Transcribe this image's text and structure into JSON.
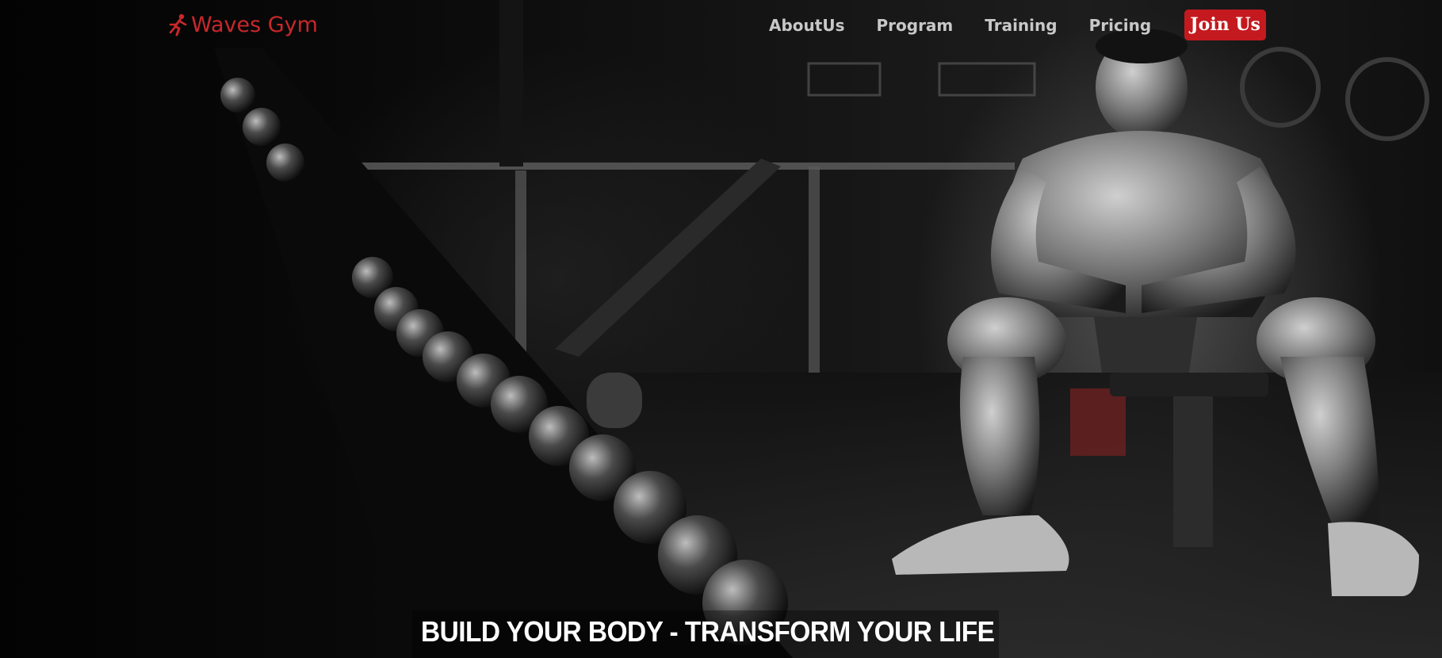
{
  "header": {
    "logo_text": "Waves Gym",
    "logo_icon": "running-man-icon"
  },
  "nav": {
    "items": [
      {
        "label": "AboutUs"
      },
      {
        "label": "Program"
      },
      {
        "label": "Training"
      },
      {
        "label": "Pricing"
      }
    ],
    "cta_label": "Join Us"
  },
  "hero": {
    "tagline": "BUILD YOUR BODY - TRANSFORM YOUR LIFE",
    "background": "dark gym photo: dumbbell rack on the left, muscular athlete sitting on a bench on the right"
  },
  "colors": {
    "brand_red": "#c9272b",
    "button_red": "#c41a1f",
    "nav_text": "#c8c8c8",
    "headline": "#ffffff"
  }
}
